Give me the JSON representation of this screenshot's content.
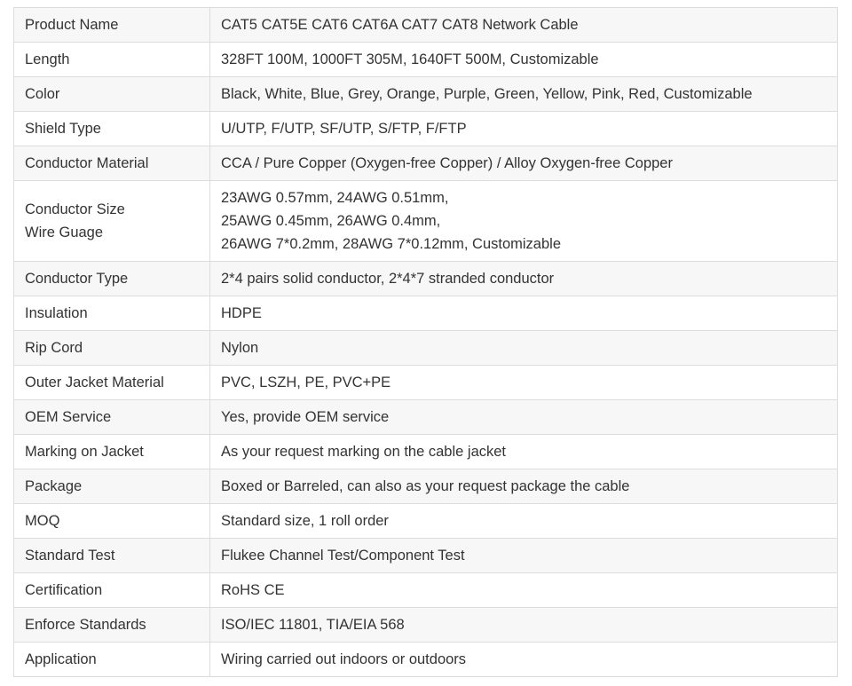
{
  "rows": [
    {
      "label": [
        "Product Name"
      ],
      "value": [
        "CAT5 CAT5E CAT6 CAT6A CAT7 CAT8 Network Cable"
      ]
    },
    {
      "label": [
        "Length"
      ],
      "value": [
        "328FT 100M, 1000FT 305M, 1640FT 500M, Customizable"
      ]
    },
    {
      "label": [
        "Color"
      ],
      "value": [
        "Black, White, Blue, Grey, Orange, Purple, Green, Yellow, Pink, Red, Customizable"
      ]
    },
    {
      "label": [
        "Shield Type"
      ],
      "value": [
        "U/UTP, F/UTP, SF/UTP, S/FTP, F/FTP"
      ]
    },
    {
      "label": [
        "Conductor Material"
      ],
      "value": [
        "CCA / Pure Copper (Oxygen-free Copper) / Alloy Oxygen-free Copper"
      ]
    },
    {
      "label": [
        "Conductor Size",
        "Wire Guage"
      ],
      "value": [
        "23AWG 0.57mm, 24AWG 0.51mm,",
        "25AWG 0.45mm, 26AWG 0.4mm,",
        "26AWG 7*0.2mm, 28AWG 7*0.12mm, Customizable"
      ]
    },
    {
      "label": [
        "Conductor Type"
      ],
      "value": [
        "2*4 pairs solid conductor, 2*4*7 stranded conductor"
      ]
    },
    {
      "label": [
        "Insulation"
      ],
      "value": [
        "HDPE"
      ]
    },
    {
      "label": [
        "Rip Cord"
      ],
      "value": [
        "Nylon"
      ]
    },
    {
      "label": [
        "Outer Jacket Material"
      ],
      "value": [
        "PVC, LSZH, PE, PVC+PE"
      ]
    },
    {
      "label": [
        "OEM Service"
      ],
      "value": [
        "Yes, provide OEM service"
      ]
    },
    {
      "label": [
        "Marking on Jacket"
      ],
      "value": [
        "As your request marking on the cable jacket"
      ]
    },
    {
      "label": [
        "Package"
      ],
      "value": [
        "Boxed or Barreled, can also as your request package the cable"
      ]
    },
    {
      "label": [
        "MOQ"
      ],
      "value": [
        "Standard size, 1 roll order"
      ]
    },
    {
      "label": [
        "Standard Test"
      ],
      "value": [
        "Flukee Channel Test/Component Test"
      ]
    },
    {
      "label": [
        "Certification"
      ],
      "value": [
        "RoHS CE"
      ]
    },
    {
      "label": [
        "Enforce Standards"
      ],
      "value": [
        "ISO/IEC 11801, TIA/EIA 568"
      ]
    },
    {
      "label": [
        "Application"
      ],
      "value": [
        "Wiring carried out indoors or outdoors"
      ]
    }
  ]
}
